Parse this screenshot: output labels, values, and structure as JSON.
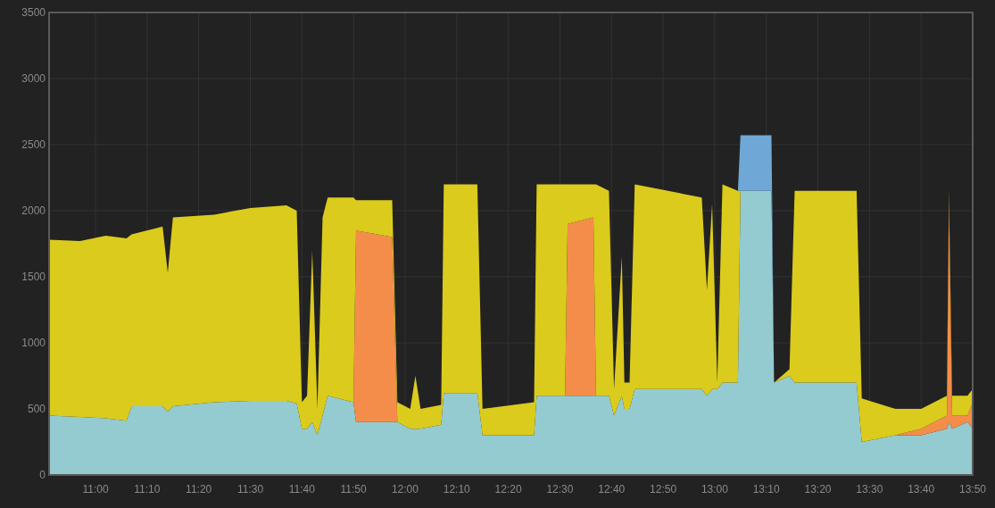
{
  "chart_data": {
    "type": "area",
    "stacked": true,
    "grid": true,
    "x": [
      651,
      657,
      662,
      666,
      667,
      673,
      674,
      675,
      683,
      690,
      697,
      699,
      700,
      701,
      702,
      703,
      704,
      705,
      710,
      710.5,
      717.5,
      718.5,
      721,
      722,
      723,
      727,
      727.5,
      734,
      735,
      745,
      745.5,
      751,
      751.5,
      756.5,
      757,
      759.5,
      760.5,
      762,
      762.5,
      763.5,
      764.5,
      777.5,
      778.5,
      779.5,
      780.5,
      781.5,
      784.5,
      785,
      791,
      791.5,
      794.5,
      795.5,
      807.5,
      808.5,
      815,
      820,
      825,
      825.4,
      826,
      829,
      830
    ],
    "series": [
      {
        "color": "#94cbd0",
        "values": [
          450,
          440,
          430,
          410,
          520,
          520,
          480,
          520,
          550,
          560,
          560,
          540,
          350,
          350,
          400,
          300,
          450,
          600,
          550,
          400,
          400,
          400,
          350,
          350,
          350,
          380,
          620,
          620,
          300,
          300,
          600,
          600,
          600,
          600,
          600,
          600,
          450,
          600,
          500,
          500,
          650,
          650,
          600,
          650,
          650,
          700,
          700,
          2150,
          2150,
          700,
          750,
          700,
          700,
          250,
          300,
          300,
          350,
          400,
          350,
          400,
          350
        ]
      },
      {
        "color": "#f58d4a",
        "values": [
          0,
          0,
          0,
          0,
          0,
          0,
          0,
          0,
          0,
          0,
          0,
          0,
          0,
          0,
          0,
          0,
          0,
          0,
          0,
          1450,
          1400,
          0,
          0,
          0,
          0,
          0,
          0,
          0,
          0,
          0,
          0,
          0,
          1300,
          1350,
          0,
          0,
          0,
          0,
          0,
          0,
          0,
          0,
          0,
          0,
          0,
          0,
          0,
          0,
          0,
          0,
          0,
          0,
          0,
          0,
          0,
          50,
          100,
          1700,
          100,
          50,
          200
        ]
      },
      {
        "color": "#dbcb1d",
        "values": [
          1330,
          1330,
          1380,
          1380,
          1300,
          1360,
          1050,
          1430,
          1420,
          1460,
          1480,
          1460,
          200,
          250,
          1300,
          200,
          1500,
          1500,
          1550,
          230,
          280,
          150,
          150,
          400,
          150,
          150,
          1580,
          1580,
          200,
          250,
          1600,
          1600,
          300,
          250,
          1600,
          1550,
          200,
          1050,
          200,
          200,
          1550,
          1450,
          800,
          1400,
          50,
          1500,
          1450,
          0,
          0,
          0,
          50,
          1450,
          1450,
          330,
          200,
          150,
          150,
          50,
          150,
          150,
          100
        ]
      },
      {
        "color": "#6fa8d6",
        "values": [
          0,
          0,
          0,
          0,
          0,
          0,
          0,
          0,
          0,
          0,
          0,
          0,
          0,
          0,
          0,
          0,
          0,
          0,
          0,
          0,
          0,
          0,
          0,
          0,
          0,
          0,
          0,
          0,
          0,
          0,
          0,
          0,
          0,
          0,
          0,
          0,
          0,
          0,
          0,
          0,
          0,
          0,
          0,
          0,
          0,
          0,
          0,
          420,
          420,
          0,
          0,
          0,
          0,
          0,
          0,
          0,
          0,
          0,
          0,
          0,
          0
        ]
      }
    ],
    "xlim": [
      651,
      830
    ],
    "ylim": [
      0,
      3500
    ],
    "yticks": [
      0,
      500,
      1000,
      1500,
      2000,
      2500,
      3000,
      3500
    ],
    "xticks": [
      {
        "value": 660,
        "label": "11:00"
      },
      {
        "value": 670,
        "label": "11:10"
      },
      {
        "value": 680,
        "label": "11:20"
      },
      {
        "value": 690,
        "label": "11:30"
      },
      {
        "value": 700,
        "label": "11:40"
      },
      {
        "value": 710,
        "label": "11:50"
      },
      {
        "value": 720,
        "label": "12:00"
      },
      {
        "value": 730,
        "label": "12:10"
      },
      {
        "value": 740,
        "label": "12:20"
      },
      {
        "value": 750,
        "label": "12:30"
      },
      {
        "value": 760,
        "label": "12:40"
      },
      {
        "value": 770,
        "label": "12:50"
      },
      {
        "value": 780,
        "label": "13:00"
      },
      {
        "value": 790,
        "label": "13:10"
      },
      {
        "value": 800,
        "label": "13:20"
      },
      {
        "value": 810,
        "label": "13:30"
      },
      {
        "value": 820,
        "label": "13:40"
      },
      {
        "value": 830,
        "label": "13:50"
      }
    ]
  }
}
